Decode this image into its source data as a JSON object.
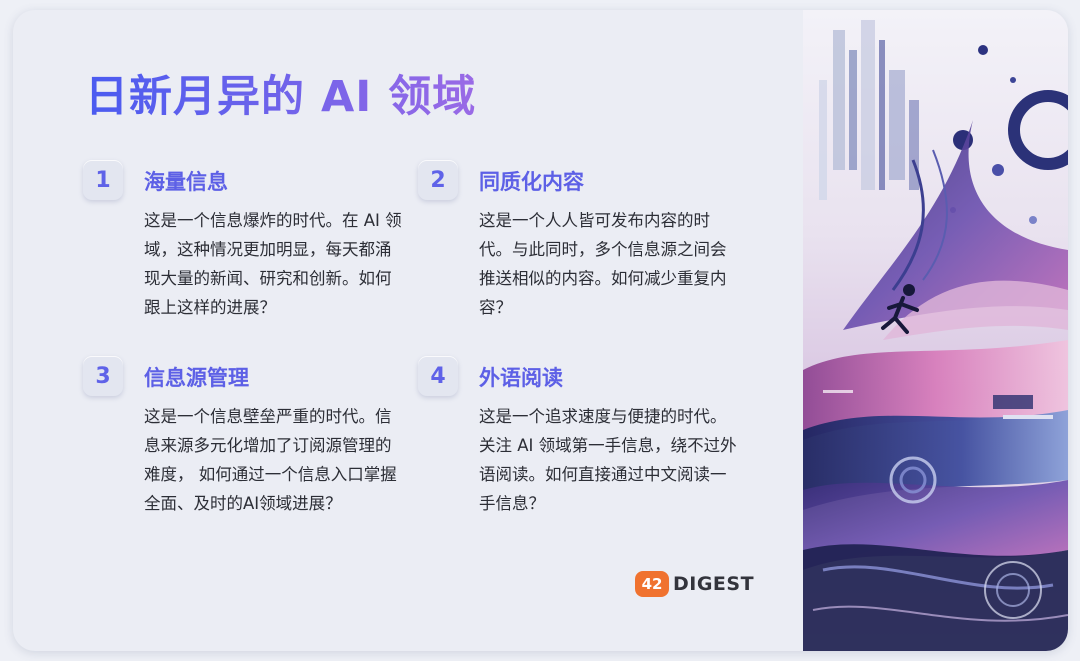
{
  "title": "日新月异的 AI 领域",
  "items": [
    {
      "number": "1",
      "title": "海量信息",
      "description": "这是一个信息爆炸的时代。在 AI 领域，这种情况更加明显，每天都涌现大量的新闻、研究和创新。如何跟上这样的进展？"
    },
    {
      "number": "2",
      "title": "同质化内容",
      "description": "这是一个人人皆可发布内容的时代。与此同时，多个信息源之间会推送相似的内容。如何减少重复内容？"
    },
    {
      "number": "3",
      "title": "信息源管理",
      "description": "这是一个信息壁垒严重的时代。信息来源多元化增加了订阅源管理的难度， 如何通过一个信息入口掌握全面、及时的AI领域进展？"
    },
    {
      "number": "4",
      "title": "外语阅读",
      "description": "这是一个追求速度与便捷的时代。关注 AI 领域第一手信息，绕不过外语阅读。如何直接通过中文阅读一手信息？"
    }
  ],
  "logo": {
    "badge": "42",
    "text": "DIGEST"
  },
  "colors": {
    "accent": "#5d60e6",
    "logo_badge": "#f0722f",
    "card_background": "#ebedf4"
  }
}
